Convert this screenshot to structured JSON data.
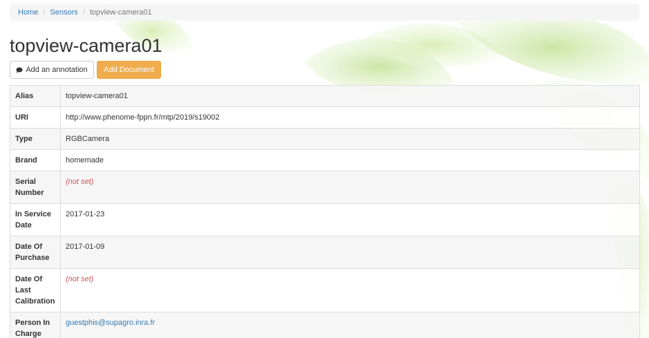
{
  "breadcrumb": {
    "home": "Home",
    "sensors": "Sensors",
    "current": "topview-camera01"
  },
  "title": "topview-camera01",
  "buttons": {
    "annotation": "Add an annotation",
    "document": "Add Document"
  },
  "details": [
    {
      "label": "Alias",
      "value": "topview-camera01",
      "type": "text"
    },
    {
      "label": "URI",
      "value": "http://www.phenome-fppn.fr/mtp/2019/s19002",
      "type": "text"
    },
    {
      "label": "Type",
      "value": "RGBCamera",
      "type": "text"
    },
    {
      "label": "Brand",
      "value": "homemade",
      "type": "text"
    },
    {
      "label": "Serial Number",
      "value": "(not set)",
      "type": "notset"
    },
    {
      "label": "In Service Date",
      "value": "2017-01-23",
      "type": "text"
    },
    {
      "label": "Date Of Purchase",
      "value": "2017-01-09",
      "type": "text"
    },
    {
      "label": "Date Of Last Calibration",
      "value": "(not set)",
      "type": "notset"
    },
    {
      "label": "Person In Charge",
      "value": "guestphis@supagro.inra.fr",
      "type": "link"
    }
  ],
  "colors": {
    "link": "#337ab7",
    "warning": "#f0ad4e",
    "notset": "#cc5555"
  }
}
